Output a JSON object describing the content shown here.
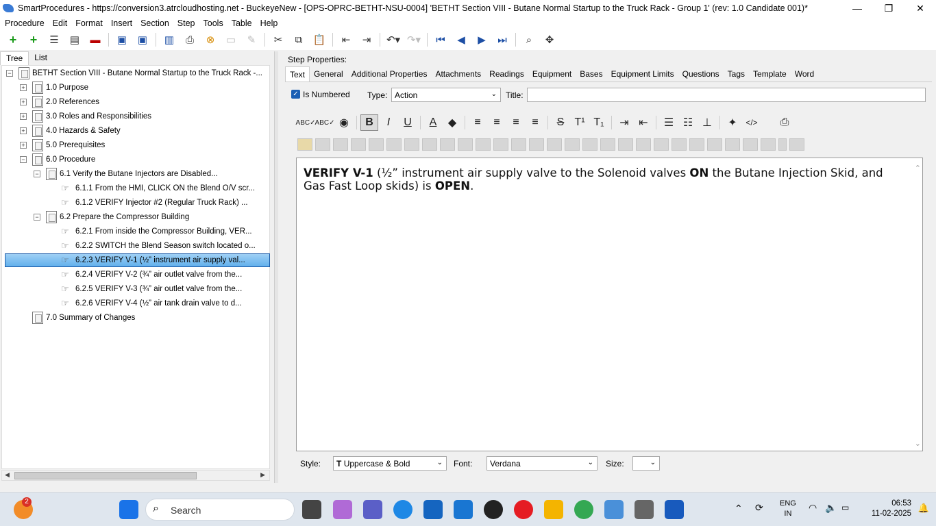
{
  "window": {
    "title": "SmartProcedures - https://conversion3.atrcloudhosting.net - BuckeyeNew - [OPS-OPRC-BETHT-NSU-0004] 'BETHT Section VIII - Butane Normal Startup to the Truck Rack - Group 1' (rev: 1.0 Candidate 001)*",
    "minimize": "—",
    "restore": "❐",
    "close": "✕"
  },
  "menu": [
    "Procedure",
    "Edit",
    "Format",
    "Insert",
    "Section",
    "Step",
    "Tools",
    "Table",
    "Help"
  ],
  "left_tabs": [
    "Tree",
    "List"
  ],
  "tree": [
    {
      "label": "BETHT Section VIII - Butane Normal Startup to the Truck Rack -...",
      "exp": "−"
    },
    {
      "label": "1.0 Purpose",
      "exp": "+"
    },
    {
      "label": "2.0 References",
      "exp": "+"
    },
    {
      "label": "3.0 Roles and Responsibilities",
      "exp": "+"
    },
    {
      "label": "4.0 Hazards & Safety",
      "exp": "+"
    },
    {
      "label": "5.0 Prerequisites",
      "exp": "+"
    },
    {
      "label": "6.0 Procedure",
      "exp": "−"
    },
    {
      "label": "6.1 Verify the Butane Injectors are Disabled...",
      "exp": "−"
    },
    {
      "label": "6.1.1 From the HMI, CLICK ON the Blend O/V scr..."
    },
    {
      "label": "6.1.2 VERIFY Injector #2 (Regular Truck Rack) ..."
    },
    {
      "label": "6.2 Prepare the Compressor Building",
      "exp": "−"
    },
    {
      "label": "6.2.1 From inside the Compressor Building, VER..."
    },
    {
      "label": "6.2.2 SWITCH the Blend Season switch located o..."
    },
    {
      "label": "6.2.3 VERIFY V-1 (½” instrument air supply val..."
    },
    {
      "label": "6.2.4 VERIFY V-2 (¾” air outlet valve from the..."
    },
    {
      "label": "6.2.5 VERIFY V-3 (¾” air outlet valve from the..."
    },
    {
      "label": "6.2.6 VERIFY V-4 (½” air tank drain valve to d..."
    },
    {
      "label": "7.0 Summary of Changes"
    }
  ],
  "step_properties_label": "Step Properties:",
  "right_tabs": [
    "Text",
    "General",
    "Additional Properties",
    "Attachments",
    "Readings",
    "Equipment",
    "Bases",
    "Equipment Limits",
    "Questions",
    "Tags",
    "Template",
    "Word"
  ],
  "step": {
    "is_numbered_label": "Is Numbered",
    "type_label": "Type:",
    "type_value": "Action",
    "title_label": "Title:",
    "title_value": ""
  },
  "editor": {
    "p1": "VERIFY V-1",
    "p2": " (½” instrument air supply valve to the Solenoid valves ",
    "p3": "ON",
    "p4": " the Butane Injection Skid, and Gas Fast Loop skids) is ",
    "p5": "OPEN",
    "p6": "."
  },
  "bottom": {
    "style_label": "Style:",
    "style_value": "Uppercase & Bold",
    "font_label": "Font:",
    "font_value": "Verdana",
    "size_label": "Size:",
    "size_value": ""
  },
  "taskbar": {
    "search": "Search",
    "lang1": "ENG",
    "lang2": "IN",
    "time": "06:53",
    "date": "11-02-2025",
    "badge": "2"
  }
}
